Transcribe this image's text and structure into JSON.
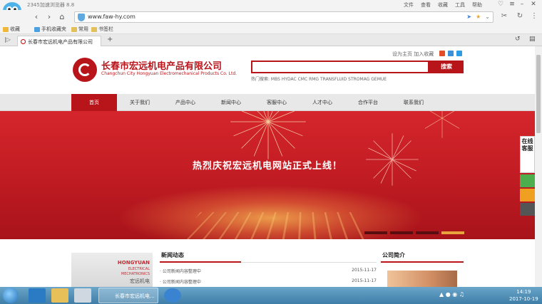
{
  "browser": {
    "title": "2345加速浏览器 8.8",
    "menu": [
      "文件",
      "查看",
      "收藏",
      "工具",
      "帮助"
    ],
    "url": "www.faw-hy.com",
    "bookmarks": [
      "收藏",
      "手机收藏夹",
      "常用",
      "书签栏"
    ],
    "tab_title": "长春市宏远机电产品有限公司"
  },
  "site": {
    "company_name": "长春市宏远机电产品有限公司",
    "company_en": "Changchun City Hongyuan Electromechanical Products Co. Ltd.",
    "quick_links": "设为主页  加入收藏",
    "search_button": "搜索",
    "hot_words": "热门搜索: MBS HYDAC CMC RMG TRANSFLUID STROMAG GEMUE",
    "menu": [
      "首页",
      "关于我们",
      "产品中心",
      "新闻中心",
      "客服中心",
      "人才中心",
      "合作平台",
      "联系我们"
    ],
    "banner_text": "热烈庆祝宏远机电网站正式上线！",
    "news_title": "新闻动态",
    "news": [
      {
        "title": "· 公司新闻内容整理中",
        "date": "2015-11-17"
      },
      {
        "title": "· 公司新闻内容整理中",
        "date": "2015-11-17"
      }
    ],
    "news_img": {
      "t1": "HONGYUAN",
      "t2": "ELECTRICAL",
      "t3": "MECHATRONICS",
      "t4": "宏远机电"
    },
    "about_title": "公司简介",
    "side_service": "在线客服"
  },
  "taskbar": {
    "active_window": "长春市宏远机电...",
    "time": "14:19",
    "date": "2017-10-19"
  },
  "colors": {
    "brand_red": "#b8151b"
  }
}
